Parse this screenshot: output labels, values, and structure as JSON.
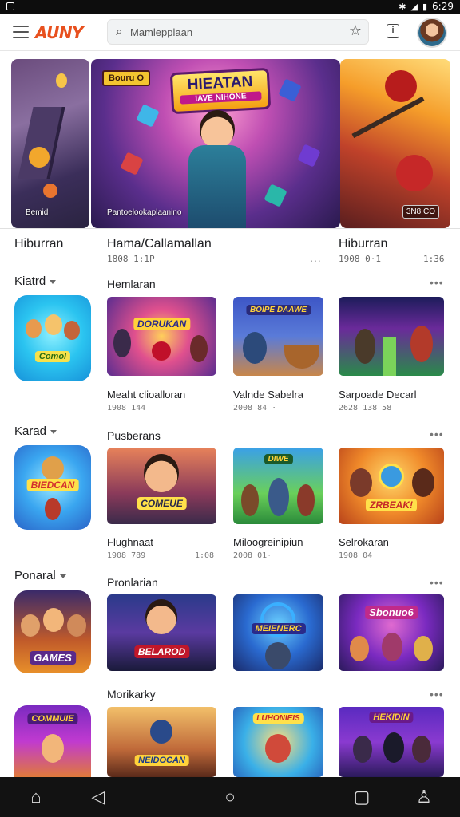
{
  "status_bar": {
    "time": "6:29",
    "icons": [
      "bluetooth-icon",
      "wifi-icon",
      "signal-icon",
      "battery-icon"
    ]
  },
  "app_bar": {
    "logo": "AUNY",
    "search_placeholder": "Mamlepplaan",
    "avatar_badge": ""
  },
  "hero": {
    "left_caption": "Bemid",
    "center_tag": "Bouru O",
    "center_title": "HIEATAN",
    "center_subtitle": "IAVE NIHONE",
    "center_caption": "Pantoelookaplaanino",
    "right_caption": "3N8 CO"
  },
  "top_row": [
    {
      "title": "Hiburran",
      "meta": ""
    },
    {
      "title": "Hama/Callamallan",
      "meta": "1808 1:1P",
      "more": "..."
    },
    {
      "title": "Hiburran",
      "meta": "1908 0·1",
      "more": "1:36"
    }
  ],
  "sections": [
    {
      "category": "Kiatrd",
      "title": "Hemlaran",
      "icon_label": "Comol",
      "items": [
        {
          "title": "Meaht clioalloran",
          "meta": "1908 144",
          "art": "DORUKAN"
        },
        {
          "title": "Valnde Sabelra",
          "meta": "2008 84 ·",
          "art": "BOIPE DAAWE"
        },
        {
          "title": "Sarpoade Decarl",
          "meta": "2628 138 58",
          "art": ""
        }
      ]
    },
    {
      "category": "Karad",
      "title": "Pusberans",
      "icon_label": "BIEDCAN",
      "items": [
        {
          "title": "Flughnaat",
          "meta": "1908 789",
          "meta2": "1:08",
          "art": "COMEUE"
        },
        {
          "title": "Miloogreinipiun",
          "meta": "2008 01·",
          "art": "DIWE"
        },
        {
          "title": "Selrokaran",
          "meta": "1908 04",
          "art": "ZRBEAK!"
        }
      ]
    },
    {
      "category": "Ponaral",
      "title": "Pronlarian",
      "icon_label": "GAMES",
      "items": [
        {
          "title": "",
          "meta": "",
          "art": "BELAROD"
        },
        {
          "title": "",
          "meta": "",
          "art": "MEIENERC"
        },
        {
          "title": "",
          "meta": "",
          "art": "Sbonuo6"
        }
      ]
    },
    {
      "category": "",
      "title": "Morikarky",
      "icon_label": "COMMUIE",
      "items": [
        {
          "title": "",
          "meta": "",
          "art": "NEIDOCAN"
        },
        {
          "title": "",
          "meta": "",
          "art": "LUHONIEIS"
        },
        {
          "title": "",
          "meta": "",
          "art": "HEKIDIN"
        }
      ]
    }
  ],
  "nav": [
    "home-icon",
    "back-icon",
    "circle-home-icon",
    "recents-icon",
    "profile-icon"
  ],
  "colors": {
    "logo": "#e8501e",
    "nav_bg": "#121212",
    "accent_red": "#e53935"
  }
}
